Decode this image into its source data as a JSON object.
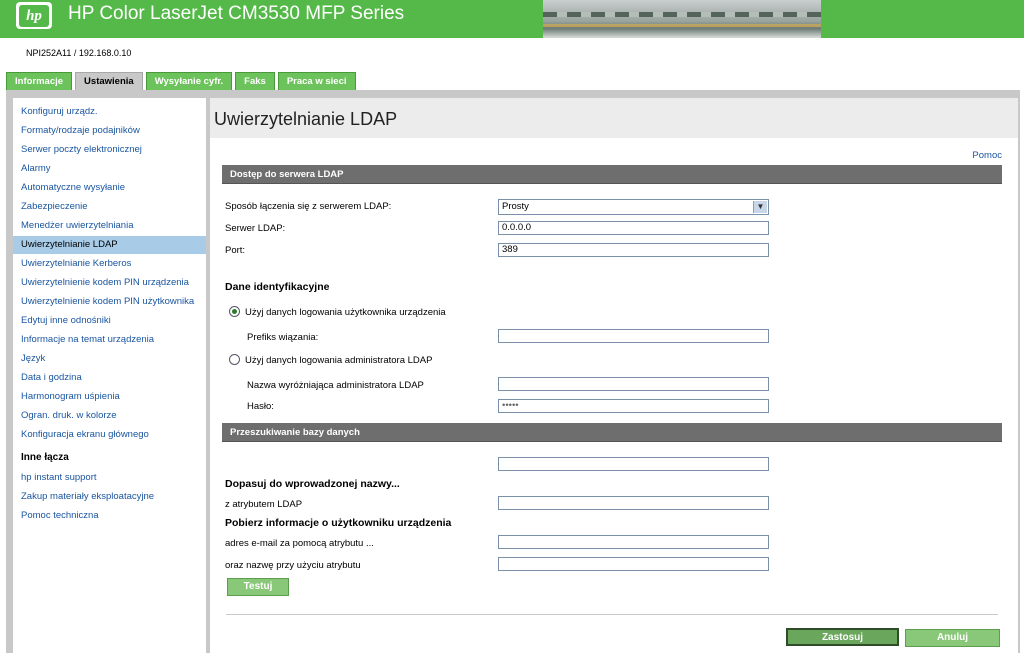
{
  "header": {
    "logo_text": "hp",
    "product_title": "HP Color LaserJet CM3530 MFP Series",
    "device_id": "NPI252A11 / 192.168.0.10"
  },
  "tabs": [
    {
      "label": "Informacje"
    },
    {
      "label": "Ustawienia"
    },
    {
      "label": "Wysyłanie cyfr."
    },
    {
      "label": "Faks"
    },
    {
      "label": "Praca w sieci"
    }
  ],
  "sidebar": {
    "items": [
      {
        "label": "Konfiguruj urządz."
      },
      {
        "label": "Formaty/rodzaje podajników"
      },
      {
        "label": "Serwer poczty elektronicznej"
      },
      {
        "label": "Alarmy"
      },
      {
        "label": "Automatyczne wysyłanie"
      },
      {
        "label": "Zabezpieczenie"
      },
      {
        "label": "Menedżer uwierzytelniania"
      },
      {
        "label": "Uwierzytelnianie LDAP"
      },
      {
        "label": "Uwierzytelnianie Kerberos"
      },
      {
        "label": "Uwierzytelnienie kodem PIN urządzenia"
      },
      {
        "label": "Uwierzytelnienie kodem PIN użytkownika"
      },
      {
        "label": "Edytuj inne odnośniki"
      },
      {
        "label": "Informacje na temat urządzenia"
      },
      {
        "label": "Język"
      },
      {
        "label": "Data i godzina"
      },
      {
        "label": "Harmonogram uśpienia"
      },
      {
        "label": "Ogran. druk. w kolorze"
      },
      {
        "label": "Konfiguracja ekranu głównego"
      }
    ],
    "other_links_heading": "Inne łącza",
    "other_links": [
      {
        "label": "hp instant support"
      },
      {
        "label": "Zakup materiały eksploatacyjne"
      },
      {
        "label": "Pomoc techniczna"
      }
    ]
  },
  "main": {
    "title": "Uwierzytelnianie LDAP",
    "help_link": "Pomoc",
    "section_server": "Dostęp do serwera LDAP",
    "connect_method_label": "Sposób łączenia się z serwerem LDAP:",
    "connect_method_value": "Prosty",
    "server_label": "Serwer LDAP:",
    "server_value": "0.0.0.0",
    "port_label": "Port:",
    "port_value": "389",
    "credentials_heading": "Dane identyfikacyjne",
    "radio_user_label": "Użyj danych logowania użytkownika urządzenia",
    "bind_prefix_label": "Prefiks wiązania:",
    "bind_prefix_value": "",
    "radio_admin_label": "Użyj danych logowania administratora LDAP",
    "admin_dn_label": "Nazwa wyróżniająca administratora LDAP",
    "admin_dn_value": "",
    "password_label": "Hasło:",
    "password_value": "•••••",
    "section_search": "Przeszukiwanie bazy danych",
    "search_root_value": "",
    "match_heading": "Dopasuj do wprowadzonej nazwy...",
    "attribute_label": "z atrybutem LDAP",
    "attribute_value": "",
    "retrieve_heading": "Pobierz informacje o użytkowniku urządzenia",
    "email_attr_label": "adres e-mail za pomocą atrybutu ...",
    "email_attr_value": "",
    "name_attr_label": "oraz nazwę przy użyciu atrybutu",
    "name_attr_value": "",
    "test_button": "Testuj",
    "apply_button": "Zastosuj",
    "cancel_button": "Anuluj"
  }
}
